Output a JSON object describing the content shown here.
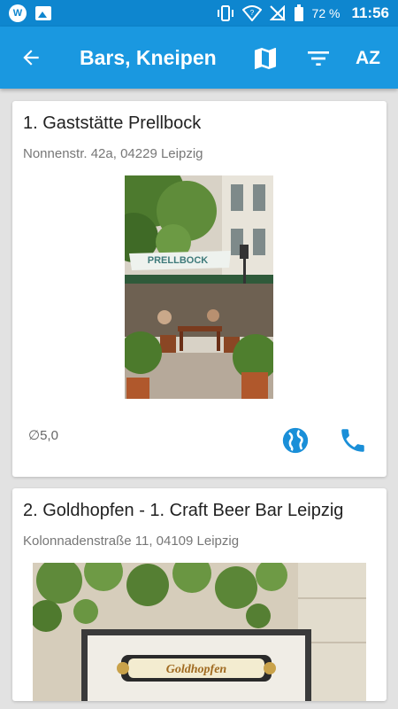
{
  "status": {
    "battery_text": "72 %",
    "time": "11:56"
  },
  "appbar": {
    "title": "Bars, Kneipen",
    "sort_label": "AZ"
  },
  "items": [
    {
      "title": "1. Gaststätte Prellbock",
      "address": "Nonnenstr. 42a, 04229 Leipzig",
      "photo_text": "PRELLBOCK",
      "rating": "∅5,0"
    },
    {
      "title": "2. Goldhopfen - 1. Craft Beer Bar Leipzig",
      "address": "Kolonnadenstraße 11, 04109 Leipzig",
      "photo_text": "Goldhopfen"
    }
  ],
  "colors": {
    "status_bar": "#0e86cf",
    "app_bar": "#1a98e0",
    "accent": "#1a8fd8"
  }
}
